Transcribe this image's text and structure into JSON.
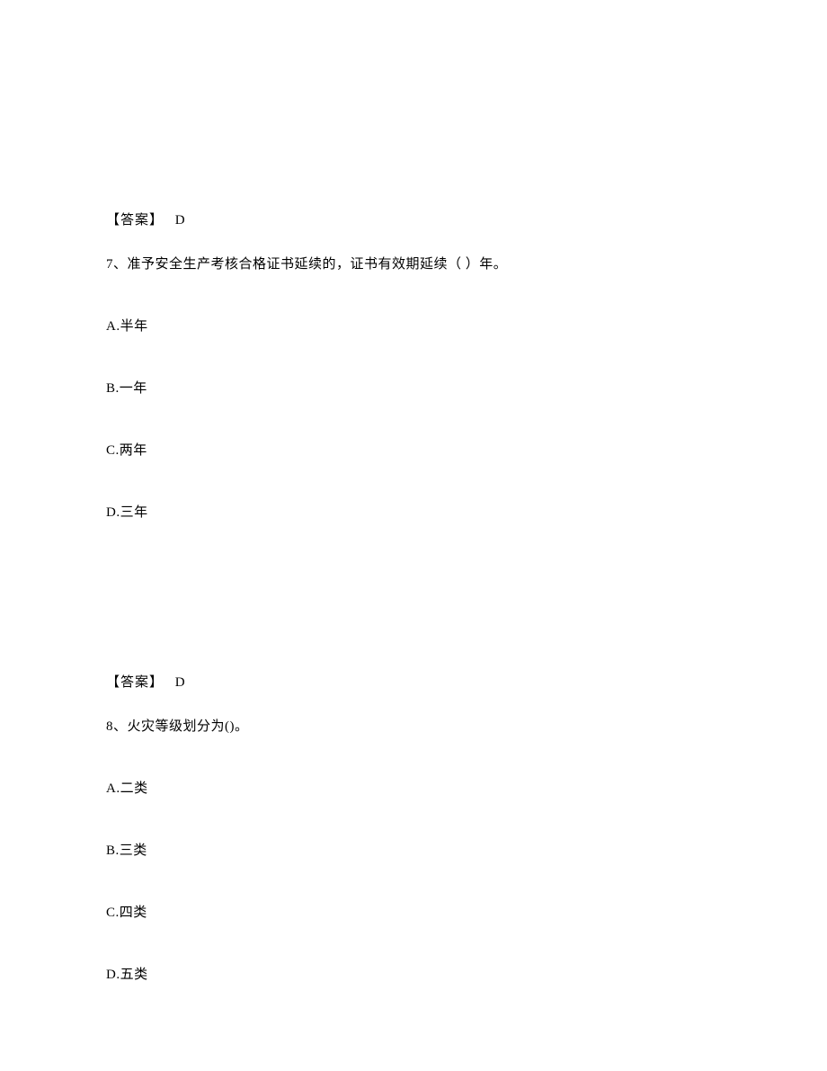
{
  "block1": {
    "answer_label": "【答案】",
    "answer_letter": "D",
    "question_text": "7、准予安全生产考核合格证书延续的，证书有效期延续（    ）年。",
    "options": {
      "a": "A.半年",
      "b": "B.一年",
      "c": "C.两年",
      "d": "D.三年"
    }
  },
  "block2": {
    "answer_label": "【答案】",
    "answer_letter": "D",
    "question_text": "8、火灾等级划分为()。",
    "options": {
      "a": "A.二类",
      "b": "B.三类",
      "c": "C.四类",
      "d": "D.五类"
    }
  }
}
